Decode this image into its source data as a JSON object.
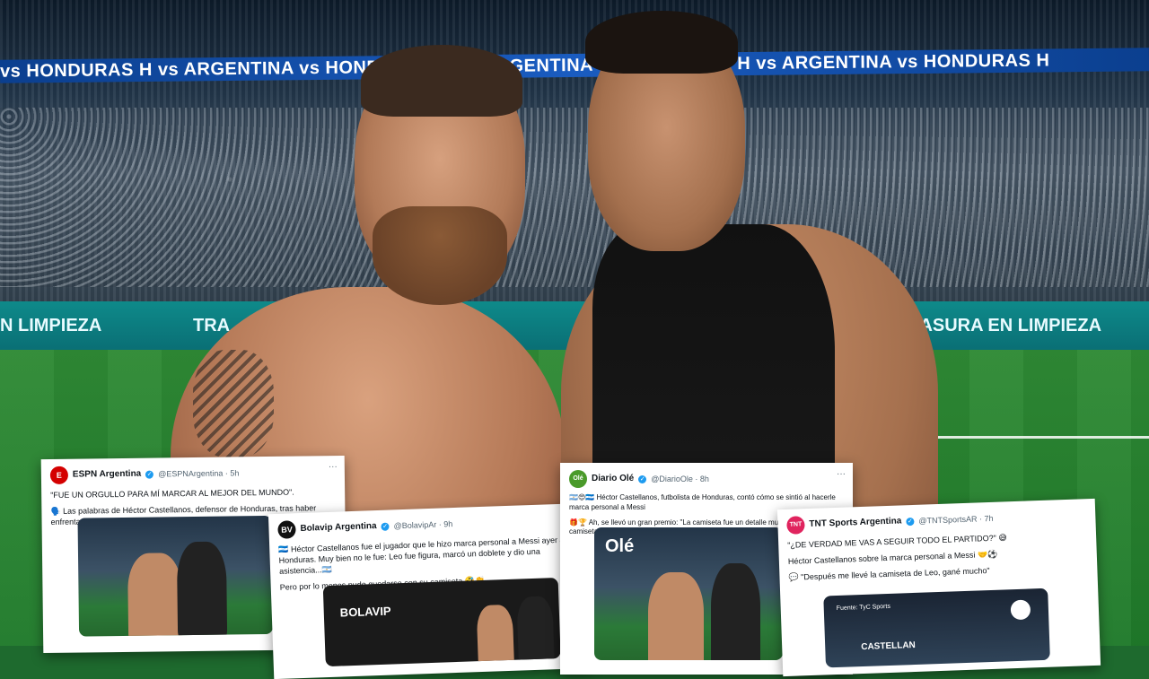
{
  "stadium": {
    "banner_text": "vs HONDURAS H vs ARGENTINA vs HONDURAS H vs ARGENTINA vs HONDURAS H vs ARGENTINA vs HONDURAS H",
    "ad_left": "N LIMPIEZA",
    "ad_center": "TRA",
    "ad_right": "BASURA EN LIMPIEZA"
  },
  "cards": [
    {
      "author": "ESPN Argentina",
      "handle": "@ESPNArgentina · 5h",
      "avatar_text": "E",
      "avatar_color": "#d40000",
      "lines": [
        "\"FUE UN ORGULLO PARA MÍ MARCAR AL MEJOR DEL MUNDO\".",
        "🗣️ Las palabras de Héctor Castellanos, defensor de Honduras, tras haber enfrentado (y perseguido) a Lionel Messi durante el amistoso."
      ]
    },
    {
      "author": "Bolavip Argentina",
      "handle": "@BolavipAr · 9h",
      "avatar_text": "BV",
      "avatar_color": "#111111",
      "lines": [
        "🇭🇳 Héctor Castellanos fue el jugador que le hizo marca personal a Messi ayer ante Honduras. Muy bien no le fue: Leo fue figura, marcó un doblete y dio una asistencia...🇦🇷",
        "Pero por lo menos pudo quedarse con su camiseta 🤣👏"
      ],
      "media_tag": "BOLAVIP"
    },
    {
      "author": "Diario Olé",
      "handle": "@DiarioOle · 8h",
      "avatar_text": "Olé",
      "avatar_color": "#4a9a2a",
      "lines": [
        "🇦🇷😍🇭🇳 Héctor Castellanos, futbolista de Honduras, contó cómo se sintió al hacerle marca personal a Messi",
        "🎁🏆 Ah, se llevó un gran premio: \"La camiseta fue un detalle muy lindo. Tener la camiseta del mejor del mundo es un privilegio\""
      ],
      "media_tag": "Olé"
    },
    {
      "author": "TNT Sports Argentina",
      "handle": "@TNTSportsAR · 7h",
      "avatar_text": "TNT",
      "avatar_color": "#e0245e",
      "lines": [
        "\"¿DE VERDAD ME VAS A SEGUIR TODO EL PARTIDO?\" 😅",
        "Héctor Castellanos sobre la marca personal a Messi 🤝⚽",
        "💬 \"Después me llevé la camiseta de Leo, gané mucho\""
      ],
      "media_tag": "Fuente: TyC Sports",
      "media_label": "CASTELLAN"
    }
  ]
}
